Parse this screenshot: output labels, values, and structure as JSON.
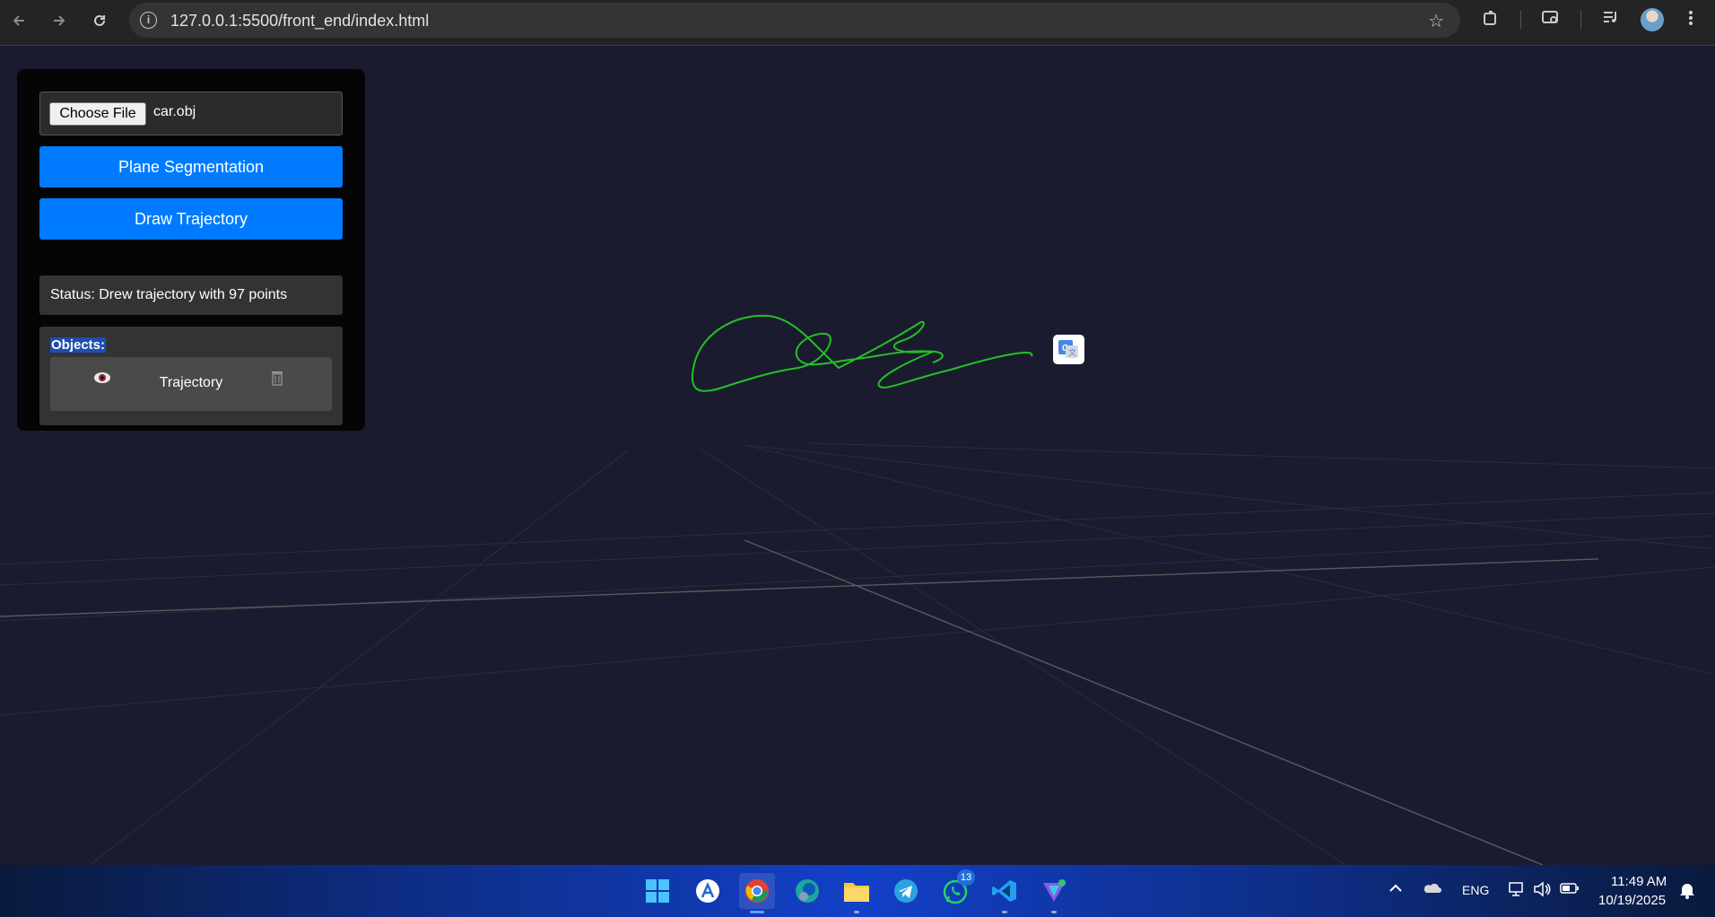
{
  "browser": {
    "url": "127.0.0.1:5500/front_end/index.html"
  },
  "panel": {
    "choose_file_label": "Choose File",
    "file_name": "car.obj",
    "plane_segmentation_label": "Plane Segmentation",
    "draw_trajectory_label": "Draw Trajectory",
    "status_text": "Status: Drew trajectory with 97 points",
    "objects_title": "Objects:",
    "objects": [
      {
        "label": "Trajectory",
        "visible_icon": "eye-icon",
        "delete_icon": "trash-icon"
      }
    ]
  },
  "scene": {
    "trajectory_color": "#22c222",
    "grid_color": "#4a4a4a",
    "background_color": "#1b1b30"
  },
  "taskbar": {
    "apps": [
      "start-icon",
      "app-store-icon",
      "chrome-icon",
      "edge-icon",
      "file-explorer-icon",
      "telegram-icon",
      "whatsapp-icon",
      "vscode-icon",
      "vpn-icon"
    ],
    "whatsapp_badge": "13",
    "language": "ENG",
    "time": "11:49 AM",
    "date": "10/19/2025"
  },
  "colors": {
    "accent_blue": "#007bff",
    "panel_bg": "#050505",
    "chrome_bg": "#242424"
  }
}
